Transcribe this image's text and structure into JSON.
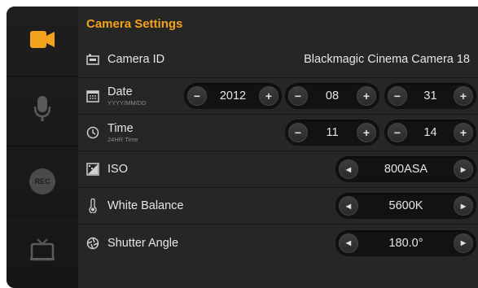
{
  "title": "Camera Settings",
  "sidebar": {
    "items": [
      {
        "icon": "camera-icon",
        "active": true
      },
      {
        "icon": "microphone-icon",
        "active": false
      },
      {
        "icon": "rec-icon",
        "text": "REC",
        "active": false
      },
      {
        "icon": "monitor-icon",
        "active": false
      }
    ]
  },
  "rows": {
    "camera_id": {
      "label": "Camera ID",
      "value": "Blackmagic Cinema Camera 18"
    },
    "date": {
      "label": "Date",
      "sublabel": "YYYY/MM/DD",
      "year": "2012",
      "month": "08",
      "day": "31"
    },
    "time": {
      "label": "Time",
      "sublabel": "24HR Time",
      "hour": "11",
      "minute": "14"
    },
    "iso": {
      "label": "ISO",
      "value": "800ASA"
    },
    "white_balance": {
      "label": "White Balance",
      "value": "5600K"
    },
    "shutter_angle": {
      "label": "Shutter Angle",
      "value": "180.0°"
    }
  },
  "controls": {
    "minus": "−",
    "plus": "+",
    "left": "◀",
    "right": "▶"
  },
  "colors": {
    "accent": "#f3a21b",
    "background": "#262626",
    "sidebar": "#1a1a1a"
  }
}
